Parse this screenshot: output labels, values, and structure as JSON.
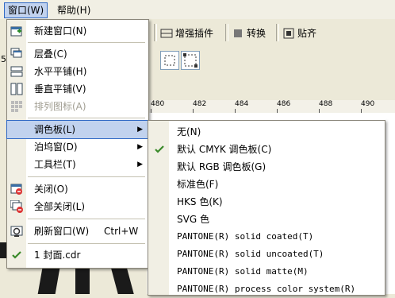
{
  "menubar": {
    "items": [
      {
        "label": "窗口(W)"
      },
      {
        "label": "帮助(H)"
      }
    ]
  },
  "toolbar": {
    "enhance_plugin": "增强插件",
    "convert": "转换",
    "paste": "贴齐",
    "partial_left": "5"
  },
  "ruler": {
    "ticks": [
      "480",
      "482",
      "484",
      "486",
      "488",
      "490"
    ]
  },
  "main_menu": {
    "items": [
      {
        "label": "新建窗口(N)",
        "icon": "new-window-icon"
      },
      {
        "label": "层叠(C)",
        "icon": "cascade-icon"
      },
      {
        "label": "水平平铺(H)",
        "icon": "tile-horizontal-icon"
      },
      {
        "label": "垂直平铺(V)",
        "icon": "tile-vertical-icon"
      },
      {
        "label": "排列图标(A)",
        "icon": "arrange-icons-icon",
        "disabled": true
      },
      {
        "label": "调色板(L)",
        "submenu": true,
        "highlighted": true
      },
      {
        "label": "泊坞窗(D)",
        "submenu": true
      },
      {
        "label": "工具栏(T)",
        "submenu": true
      },
      {
        "label": "关闭(O)",
        "icon": "close-window-icon"
      },
      {
        "label": "全部关闭(L)",
        "icon": "close-all-icon"
      },
      {
        "label": "刷新窗口(W)",
        "shortcut": "Ctrl+W",
        "icon": "refresh-window-icon"
      },
      {
        "label": "1 封面.cdr",
        "icon": "checkmark-icon",
        "checked": true
      }
    ]
  },
  "palette_submenu": {
    "items": [
      {
        "label": "无(N)"
      },
      {
        "label": "默认 CMYK 调色板(C)",
        "checked": true
      },
      {
        "label": "默认 RGB 调色板(G)"
      },
      {
        "label": "标准色(F)"
      },
      {
        "label": "HKS 色(K)"
      },
      {
        "label": "SVG 色"
      },
      {
        "label": "PANTONE(R) solid coated(T)"
      },
      {
        "label": "PANTONE(R) solid uncoated(T)"
      },
      {
        "label": "PANTONE(R) solid matte(M)"
      },
      {
        "label": "PANTONE(R) process color system(R)"
      }
    ]
  },
  "colors": {
    "highlight": "#c1d2ee",
    "highlight_border": "#316ac5",
    "check": "#3a8a2a"
  }
}
